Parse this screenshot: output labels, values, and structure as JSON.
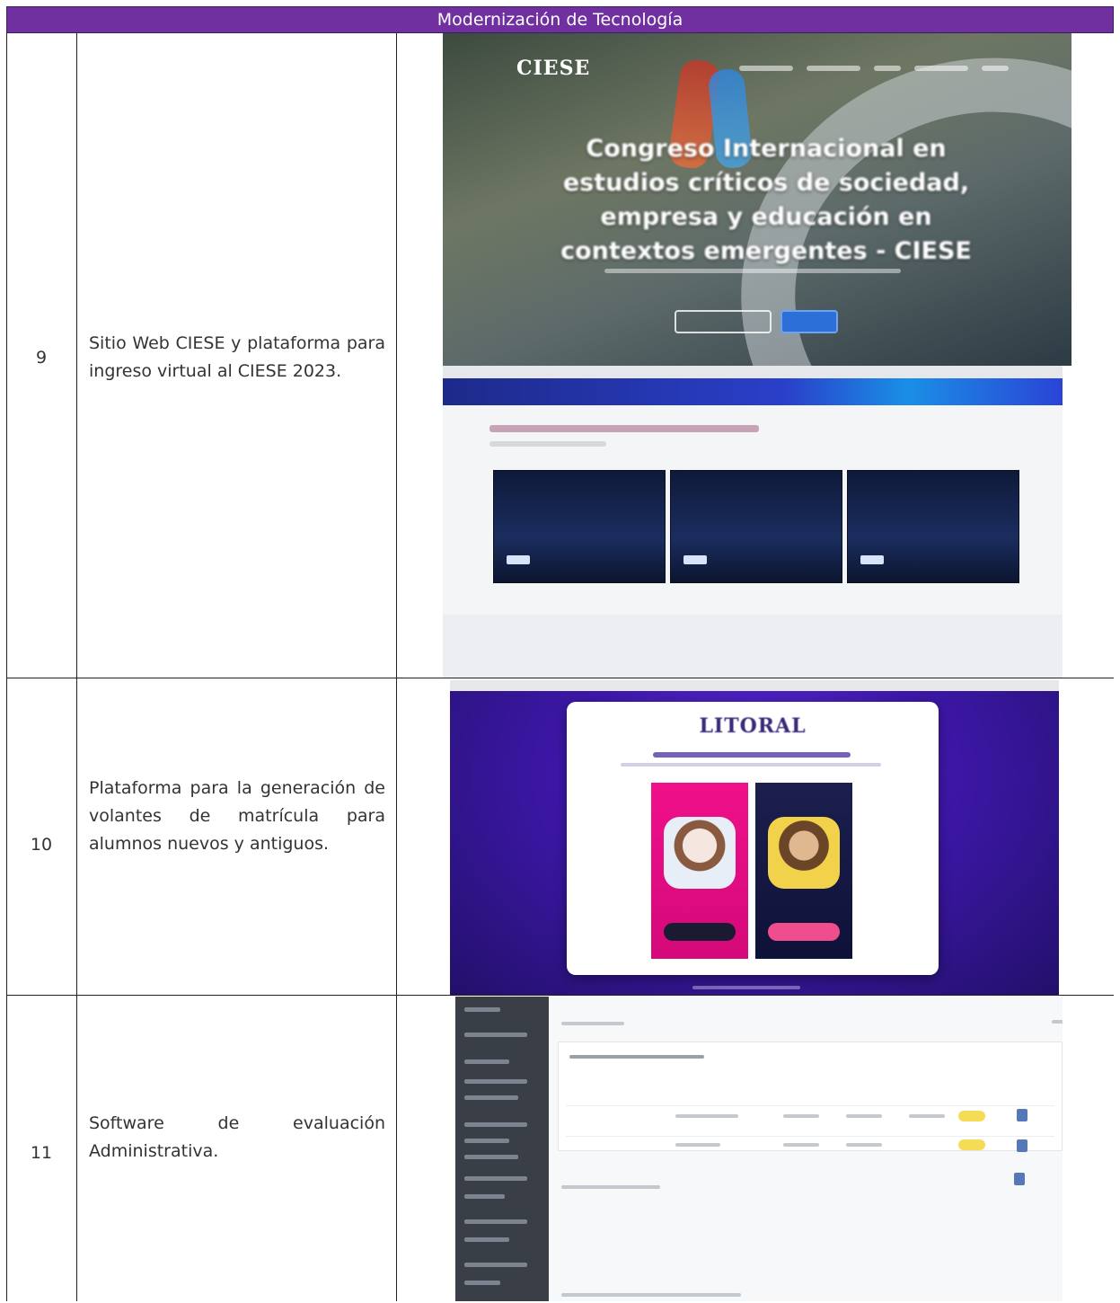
{
  "header": {
    "title": "Modernización de Tecnología"
  },
  "rows": [
    {
      "number": "9",
      "description": "Sitio Web CIESE y plataforma para ingreso virtual al CIESE 2023."
    },
    {
      "number": "10",
      "description": "Plataforma para la generación de volantes de matrícula para alumnos nuevos y antiguos."
    },
    {
      "number": "11",
      "description": "Software de evaluación Administrativa."
    }
  ],
  "screens": {
    "ciese_hero": {
      "logo": "CIESE",
      "title": "Congreso Internacional en estudios críticos de sociedad, empresa y educación en contextos emergentes - CIESE"
    },
    "litoral": {
      "brand": "LITORAL"
    }
  }
}
